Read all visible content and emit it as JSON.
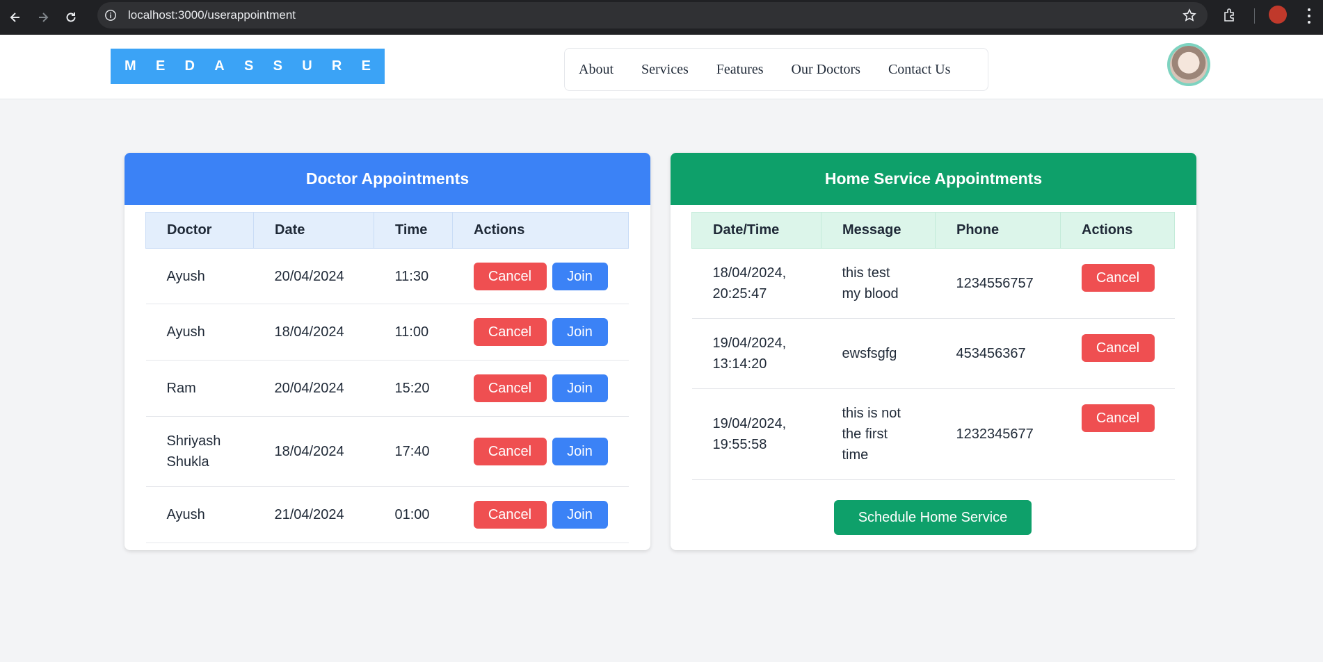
{
  "browser": {
    "url": "localhost:3000/userappointment"
  },
  "header": {
    "logo_letters": [
      "M",
      "E",
      "D",
      "A",
      "S",
      "S",
      "U",
      "R",
      "E"
    ],
    "nav": [
      "About",
      "Services",
      "Features",
      "Our Doctors",
      "Contact Us"
    ]
  },
  "doctor": {
    "title": "Doctor Appointments",
    "columns": [
      "Doctor",
      "Date",
      "Time",
      "Actions"
    ],
    "cancel_label": "Cancel",
    "join_label": "Join",
    "rows": [
      {
        "doctor": "Ayush",
        "date": "20/04/2024",
        "time": "11:30"
      },
      {
        "doctor": "Ayush",
        "date": "18/04/2024",
        "time": "11:00"
      },
      {
        "doctor": "Ram",
        "date": "20/04/2024",
        "time": "15:20"
      },
      {
        "doctor": "Shriyash Shukla",
        "date": "18/04/2024",
        "time": "17:40"
      },
      {
        "doctor": "Ayush",
        "date": "21/04/2024",
        "time": "01:00"
      }
    ]
  },
  "home": {
    "title": "Home Service Appointments",
    "columns": [
      "Date/Time",
      "Message",
      "Phone",
      "Actions"
    ],
    "cancel_label": "Cancel",
    "rows": [
      {
        "datetime": "18/04/2024, 20:25:47",
        "message": "this test my blood",
        "phone": "1234556757"
      },
      {
        "datetime": "19/04/2024, 13:14:20",
        "message": "ewsfsgfg",
        "phone": "453456367"
      },
      {
        "datetime": "19/04/2024, 19:55:58",
        "message": "this is not the first time",
        "phone": "1232345677"
      }
    ],
    "schedule_label": "Schedule Home Service"
  },
  "colors": {
    "logo_bg": "#3ba3f6",
    "doctor_header": "#3b82f6",
    "home_header": "#0ea06a",
    "cancel": "#ef4f51",
    "join": "#3b82f6"
  }
}
